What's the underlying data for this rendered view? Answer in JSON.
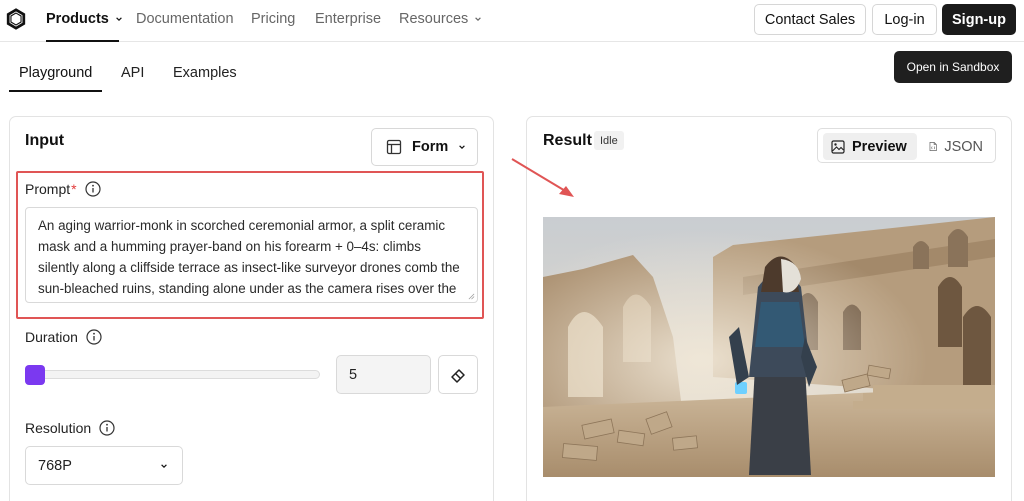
{
  "nav": {
    "items": [
      {
        "label": "Products",
        "has_chevron": true,
        "active": true
      },
      {
        "label": "Documentation",
        "has_chevron": false
      },
      {
        "label": "Pricing",
        "has_chevron": false
      },
      {
        "label": "Enterprise",
        "has_chevron": false
      },
      {
        "label": "Resources",
        "has_chevron": true
      }
    ],
    "contact_sales": "Contact Sales",
    "login": "Log-in",
    "signup": "Sign-up"
  },
  "subtabs": {
    "items": [
      "Playground",
      "API",
      "Examples"
    ],
    "active": "Playground",
    "sandbox_button": "Open in Sandbox"
  },
  "input_panel": {
    "title": "Input",
    "form_button": "Form",
    "prompt": {
      "label": "Prompt",
      "required_mark": "*",
      "value": "An aging warrior-monk in scorched ceremonial armor, a split ceramic mask and a humming prayer-band on his forearm + 0–4s: climbs silently along a cliffside terrace as insect-like surveyor drones comb the sun-bleached ruins, standing alone under as the camera rises over the ruined monastery. Sun-blasted post-"
    },
    "duration": {
      "label": "Duration",
      "value": "5",
      "slider_fraction": 0.0
    },
    "resolution": {
      "label": "Resolution",
      "value": "768P"
    }
  },
  "result_panel": {
    "title": "Result",
    "status": "Idle",
    "view_toggle": {
      "preview": "Preview",
      "json": "JSON",
      "active": "Preview"
    }
  },
  "colors": {
    "accent": "#7b39f0",
    "highlight": "#e05555",
    "dark_button": "#1b1b1b"
  },
  "icons": [
    "logo-icon",
    "chevron-down-icon",
    "form-layout-icon",
    "info-icon",
    "eraser-icon",
    "image-icon",
    "json-file-icon",
    "annotation-arrow"
  ]
}
